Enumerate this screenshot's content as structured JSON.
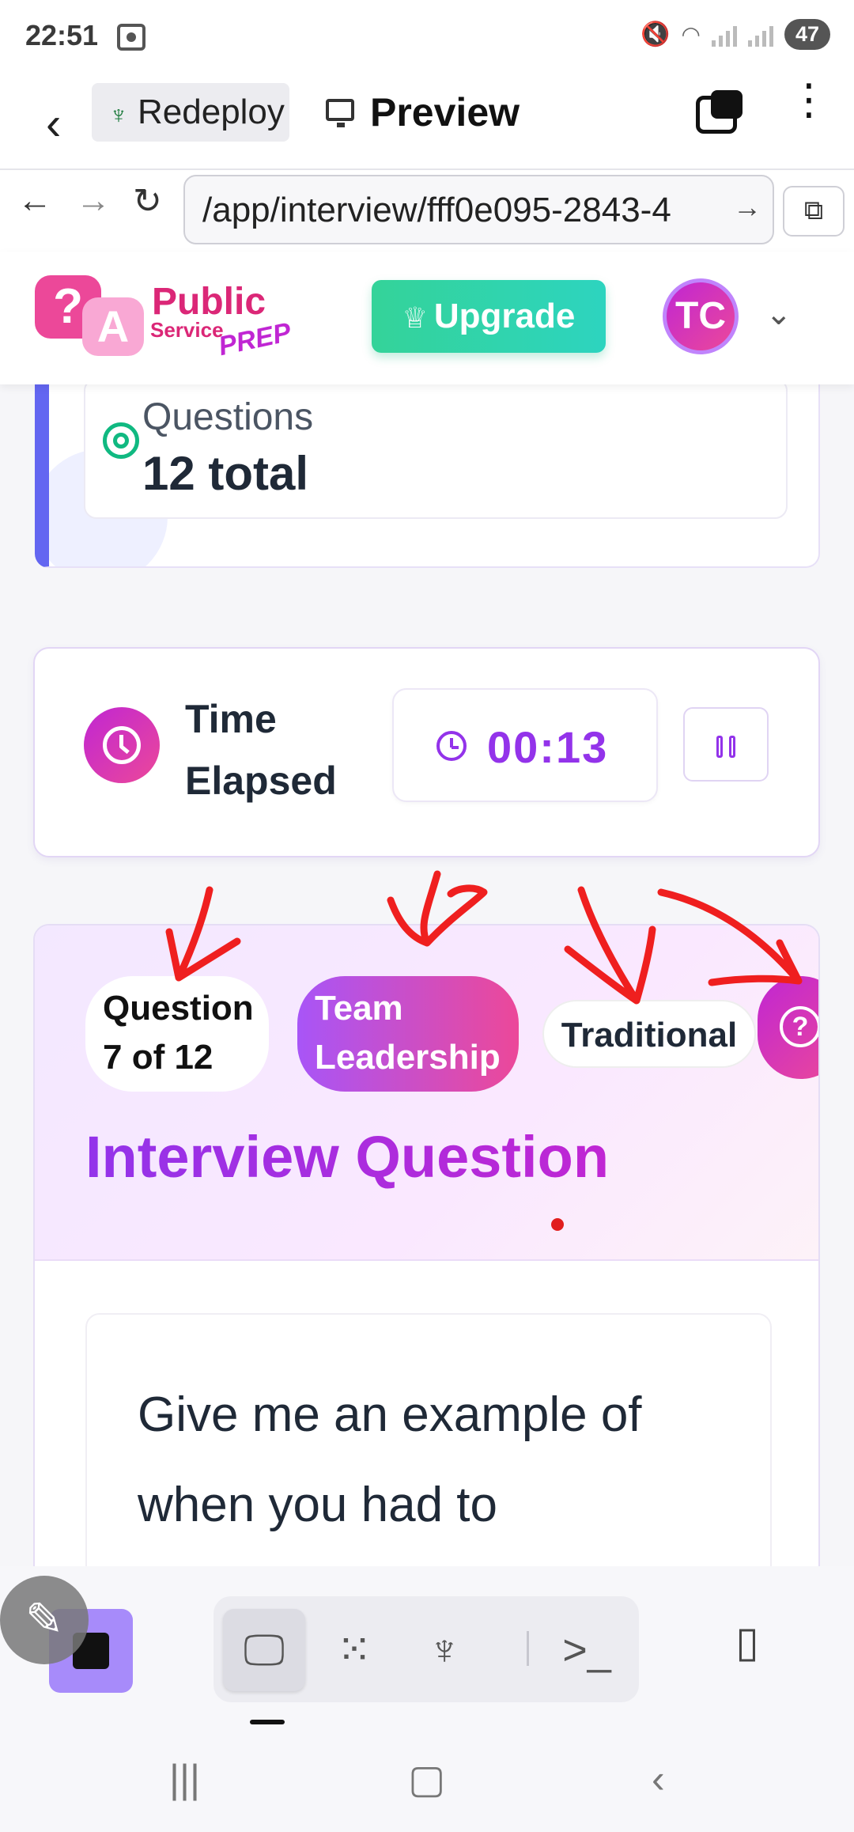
{
  "status_bar": {
    "time": "22:51",
    "battery": "47"
  },
  "browser": {
    "env_chip": "Redeploy",
    "title": "Preview",
    "url": "/app/interview/fff0e095-2843-4"
  },
  "app_header": {
    "logo_line1": "Public",
    "logo_line2": "Service",
    "logo_line3": "PREP",
    "logo_q": "?",
    "logo_a": "A",
    "upgrade_label": "Upgrade",
    "avatar_initials": "TC"
  },
  "questions_card": {
    "label": "Questions",
    "value": "12 total"
  },
  "timer_card": {
    "label": "Time Elapsed",
    "value": "00:13"
  },
  "question_card": {
    "progress": "Question 7 of 12",
    "category": "Team Leadership",
    "type": "Traditional",
    "heading": "Interview Question",
    "question_text": "Give me an example of when you had to"
  },
  "colors": {
    "accent": "#9333ea",
    "upgrade": "#34d399",
    "annotation": "#e11d1d"
  }
}
